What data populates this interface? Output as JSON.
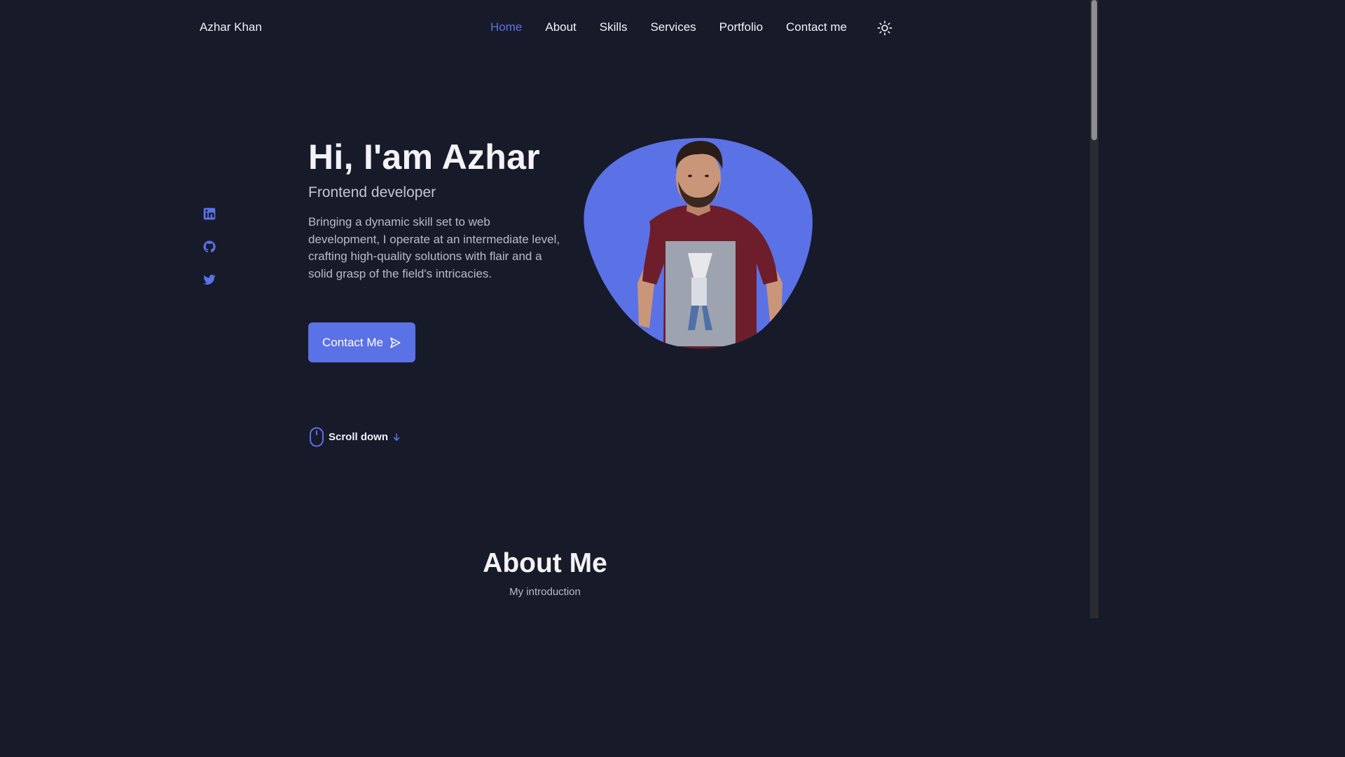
{
  "header": {
    "logo": "Azhar Khan",
    "nav": [
      "Home",
      "About",
      "Skills",
      "Services",
      "Portfolio",
      "Contact me"
    ],
    "active_nav": "Home",
    "theme_icon": "sun-icon"
  },
  "socials": [
    "linkedin-icon",
    "github-icon",
    "twitter-icon"
  ],
  "hero": {
    "title": "Hi, I'am Azhar",
    "subtitle": "Frontend developer",
    "description": "Bringing a dynamic skill set to web development, I operate at an intermediate level, crafting high-quality solutions with flair and a solid grasp of the field's intricacies.",
    "cta_label": "Contact Me",
    "cta_icon": "send-icon",
    "scroll_label": "Scroll down"
  },
  "about": {
    "title": "About Me",
    "subtitle": "My introduction"
  },
  "colors": {
    "background": "#171a29",
    "accent": "#5b71e6",
    "text": "#f2f2f7",
    "muted": "#b9bbc9"
  }
}
